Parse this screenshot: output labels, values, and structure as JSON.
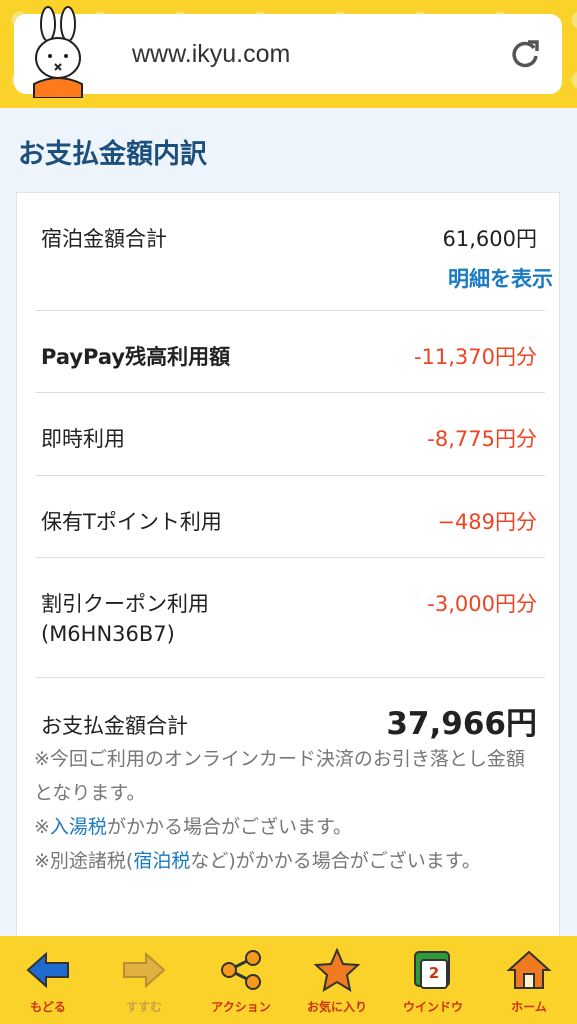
{
  "browser": {
    "url": "www.ikyu.com"
  },
  "page": {
    "title": "お支払金額内訳"
  },
  "breakdown": {
    "accommodation_label": "宿泊金額合計",
    "accommodation_value": "61,600円",
    "show_details": "明細を表示",
    "paypay_label": "PayPay残高利用額",
    "paypay_value": "-11,370円分",
    "instant_label": "即時利用",
    "instant_value": "-8,775円分",
    "tpoint_label": "保有Tポイント利用",
    "tpoint_value": "−489円分",
    "coupon_label": "割引クーポン利用",
    "coupon_code": "(M6HN36B7)",
    "coupon_value": "-3,000円分",
    "total_label": "お支払金額合計",
    "total_value": "37,966円"
  },
  "notes": {
    "note1": "※今回ご利用のオンラインカード決済のお引き落とし金額となります。",
    "note2_prefix": "※",
    "note2_link": "入湯税",
    "note2_suffix": "がかかる場合がございます。",
    "note3_prefix": "※別途諸税(",
    "note3_link": "宿泊税",
    "note3_suffix": "など)がかかる場合がございます。"
  },
  "tabbar": {
    "back": "もどる",
    "forward": "すすむ",
    "action": "アクション",
    "favorites": "お気に入り",
    "window": "ウインドウ",
    "window_count": "2",
    "home": "ホーム"
  },
  "colors": {
    "accent_yellow": "#fbd22a",
    "negative_red": "#ee4422",
    "link_blue": "#1a7ac2"
  }
}
